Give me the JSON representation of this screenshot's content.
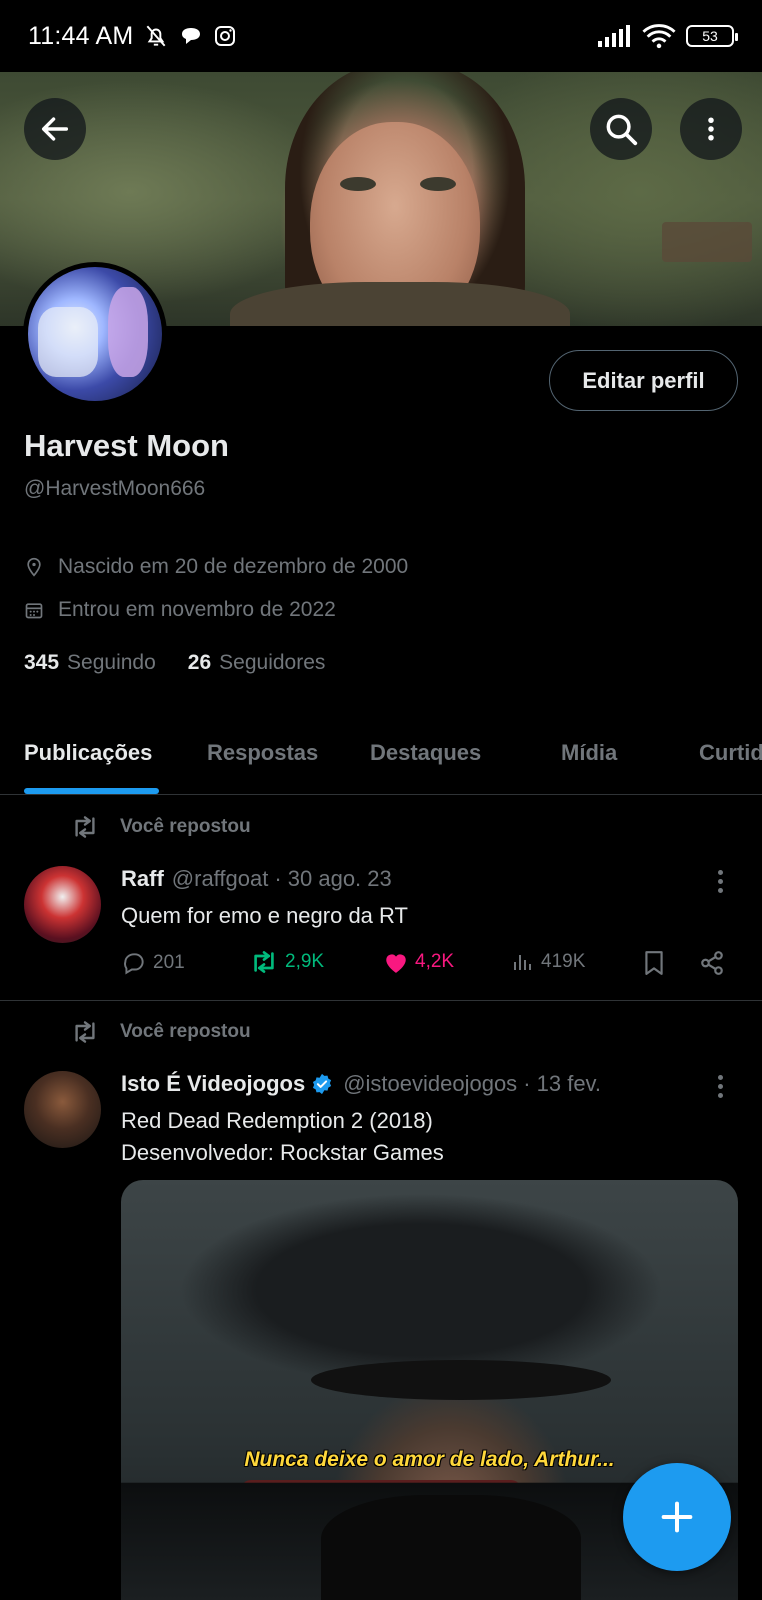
{
  "status_bar": {
    "time": "11:44 AM",
    "battery": "53"
  },
  "profile": {
    "name": "Harvest Moon",
    "handle": "@HarvestMoon666",
    "edit_button": "Editar perfil",
    "birth": "Nascido em 20 de dezembro de 2000",
    "joined": "Entrou em novembro de 2022",
    "following_count": "345",
    "following_label": "Seguindo",
    "followers_count": "26",
    "followers_label": "Seguidores"
  },
  "tabs": [
    {
      "label": "Publicações",
      "active": true
    },
    {
      "label": "Respostas"
    },
    {
      "label": "Destaques"
    },
    {
      "label": "Mídia"
    },
    {
      "label": "Curtidas"
    }
  ],
  "posts": [
    {
      "repost_label": "Você repostou",
      "author": "Raff",
      "handle": "@raffgoat",
      "time": "· 30 ago. 23",
      "text": "Quem for emo e negro da RT",
      "replies": "201",
      "reposts": "2,9K",
      "likes": "4,2K",
      "views": "419K"
    },
    {
      "repost_label": "Você repostou",
      "author": "Isto É Videojogos",
      "verified": true,
      "handle": "@istoevideojogos",
      "time": "· 13 fev.",
      "text_line1": "Red Dead Redemption 2 (2018)",
      "text_line2": "Desenvolvedor: Rockstar Games",
      "media_caption": "Nunca deixe o amor de lado, Arthur..."
    }
  ],
  "colors": {
    "accent": "#1d9bf0",
    "repost_green": "#00ba7c",
    "like_pink": "#f91880",
    "muted": "#71767b"
  }
}
